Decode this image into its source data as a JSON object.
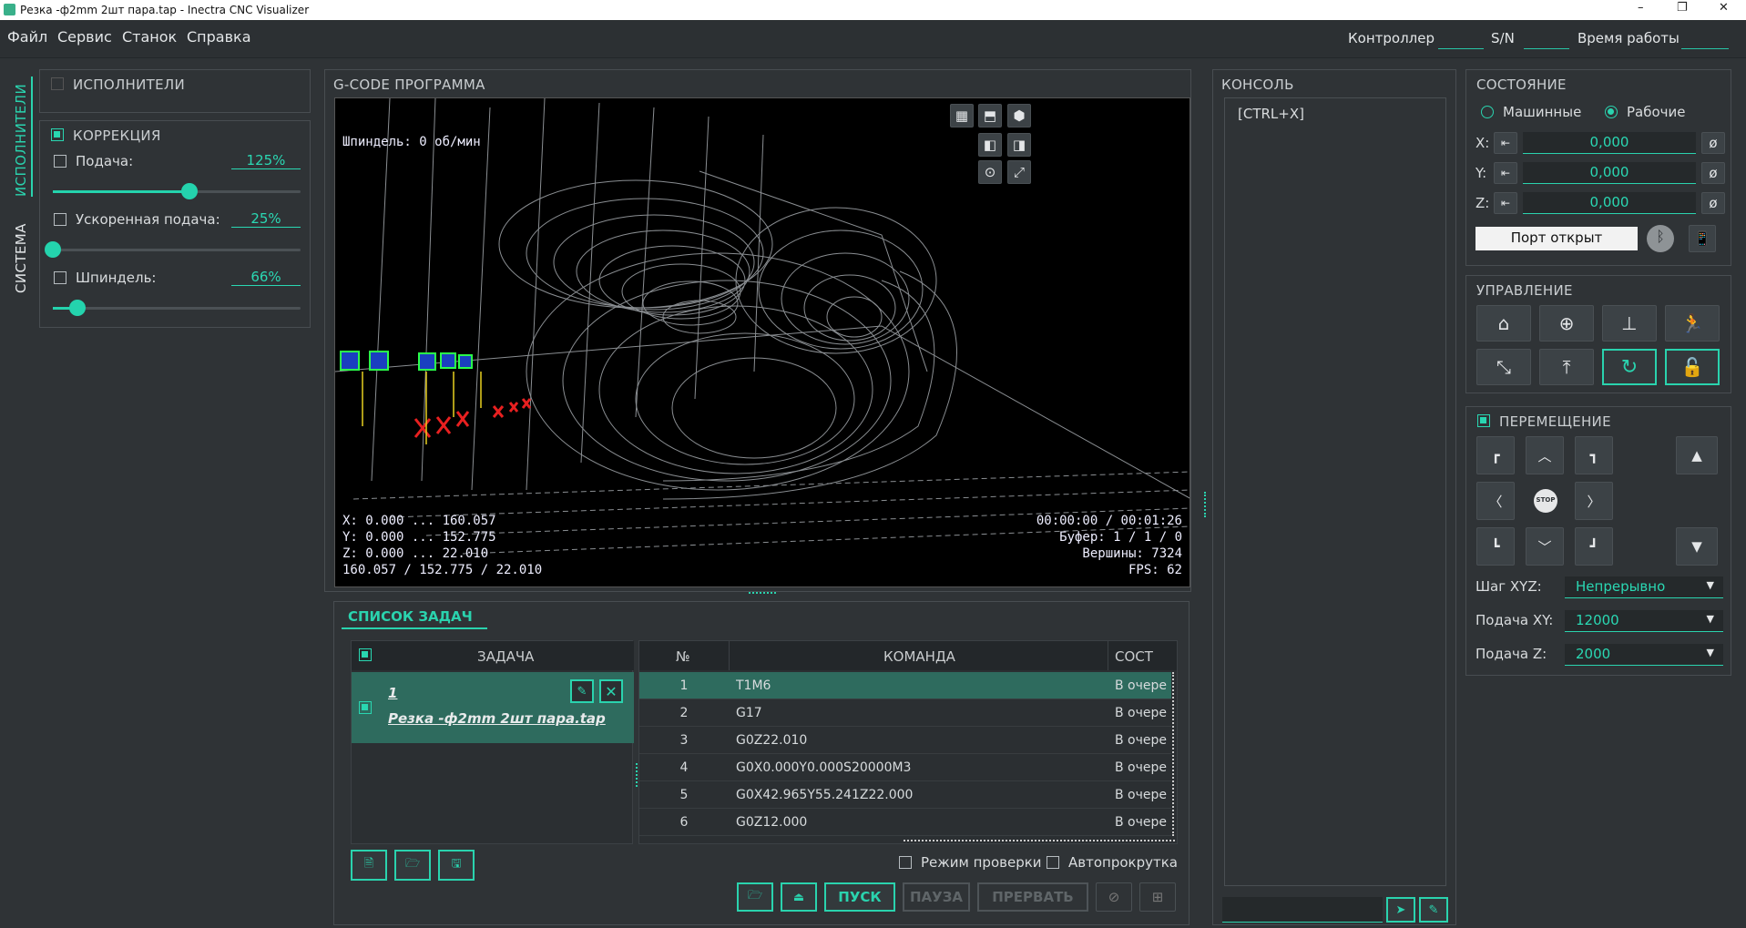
{
  "window": {
    "title": "Резка -ф2mm 2шт пара.tap - Inectra CNC Visualizer",
    "min": "–",
    "max": "❐",
    "close": "✕"
  },
  "menu": [
    "Файл",
    "Сервис",
    "Станок",
    "Справка"
  ],
  "header": {
    "controller": "Контроллер",
    "sn": "S/N",
    "uptime": "Время работы"
  },
  "sidetabs": {
    "executors": "ИСПОЛНИТЕЛИ",
    "system": "СИСТЕМА"
  },
  "executors": {
    "title": "ИСПОЛНИТЕЛИ"
  },
  "correction": {
    "title": "КОРРЕКЦИЯ",
    "feed": {
      "label": "Подача:",
      "value": "125%",
      "level": 0.55
    },
    "rapid": {
      "label": "Ускоренная подача:",
      "value": "25%",
      "level": 0.0
    },
    "spindle": {
      "label": "Шпиндель:",
      "value": "66%",
      "level": 0.1
    }
  },
  "gcode": {
    "title": "G-CODE ПРОГРАММА",
    "spindle": "Шпиндель: 0 об/мин",
    "bounds": [
      "X: 0.000 ... 160.057",
      "Y: 0.000 ... 152.775",
      "Z: 0.000 ... 22.010",
      "160.057 / 152.775 / 22.010"
    ],
    "stats": [
      "00:00:00 / 00:01:26",
      "Буфер: 1 / 1 / 0",
      "Вершины: 7324",
      "FPS: 62"
    ]
  },
  "tasks": {
    "title": "СПИСОК ЗАДАЧ",
    "col_task": "ЗАДАЧА",
    "task_num": "1",
    "task_file": "Резка -ф2mm 2шт пара.tap",
    "col_n": "№",
    "col_cmd": "КОМАНДА",
    "col_state": "СОСТ",
    "rows": [
      {
        "n": "1",
        "cmd": "T1M6",
        "state": "В очере"
      },
      {
        "n": "2",
        "cmd": "G17",
        "state": "В очере"
      },
      {
        "n": "3",
        "cmd": "G0Z22.010",
        "state": "В очере"
      },
      {
        "n": "4",
        "cmd": "G0X0.000Y0.000S20000M3",
        "state": "В очере"
      },
      {
        "n": "5",
        "cmd": "G0X42.965Y55.241Z22.000",
        "state": "В очере"
      },
      {
        "n": "6",
        "cmd": "G0Z12.000",
        "state": "В очере"
      }
    ],
    "check_mode": "Режим проверки",
    "autoscroll": "Автопрокрутка",
    "start": "ПУСК",
    "pause": "ПАУЗА",
    "abort": "ПРЕРВАТЬ"
  },
  "console": {
    "title": "КОНСОЛЬ",
    "line": "[CTRL+X]"
  },
  "state": {
    "title": "СОСТОЯНИЕ",
    "machine": "Машинные",
    "work": "Рабочие",
    "axes": [
      {
        "name": "X:",
        "value": "0,000"
      },
      {
        "name": "Y:",
        "value": "0,000"
      },
      {
        "name": "Z:",
        "value": "0,000"
      }
    ],
    "zero": "ø",
    "port": "Порт открыт"
  },
  "control": {
    "title": "УПРАВЛЕНИЕ"
  },
  "move": {
    "title": "ПЕРЕМЕЩЕНИЕ",
    "stop": "STOP",
    "step_label": "Шаг XYZ:",
    "step": "Непрерывно",
    "feedxy_label": "Подача XY:",
    "feedxy": "12000",
    "feedz_label": "Подача Z:",
    "feedz": "2000",
    "arrow": "▼"
  },
  "colors": {
    "accent": "#2ad3ae",
    "bg": "#2f3336",
    "selected_row": "#2e6b5e"
  }
}
